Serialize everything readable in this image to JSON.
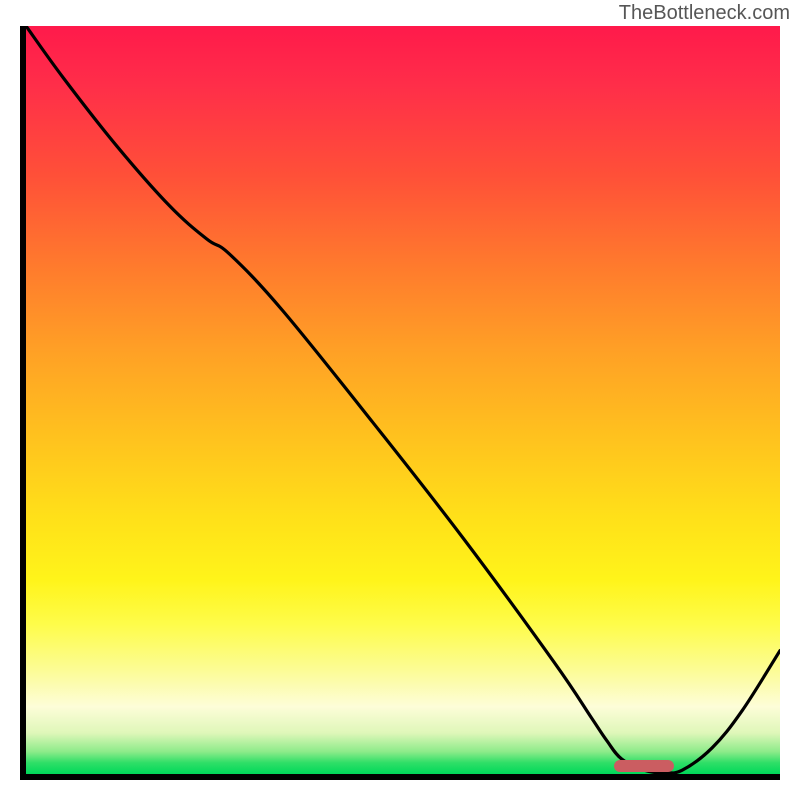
{
  "attribution": "TheBottleneck.com",
  "colors": {
    "border": "#000000",
    "curve": "#000000",
    "marker": "#cb5d61"
  },
  "chart_data": {
    "type": "line",
    "title": "",
    "xlabel": "",
    "ylabel": "",
    "xlim": [
      0,
      100
    ],
    "ylim": [
      0,
      100
    ],
    "x": [
      0.0,
      5.0,
      12.0,
      19.0,
      24.0,
      27.0,
      34.0,
      46.0,
      58.0,
      70.0,
      75.0,
      77.0,
      79.0,
      82.0,
      84.5,
      87.0,
      91.0,
      95.0,
      100.0
    ],
    "values": [
      100.0,
      93.0,
      84.0,
      76.0,
      71.5,
      69.5,
      62.0,
      47.0,
      31.5,
      15.0,
      7.5,
      4.5,
      2.0,
      0.5,
      0.2,
      0.5,
      3.5,
      8.5,
      16.5
    ],
    "annotations": [
      {
        "type": "marker",
        "x_start": 78,
        "x_end": 86,
        "y": 0
      }
    ],
    "background_gradient": {
      "top_color": "#ff1a4b",
      "mid_colors": [
        "#ff7a2d",
        "#ffe119",
        "#fcfc94"
      ],
      "bottom_color": "#00d85a"
    }
  }
}
